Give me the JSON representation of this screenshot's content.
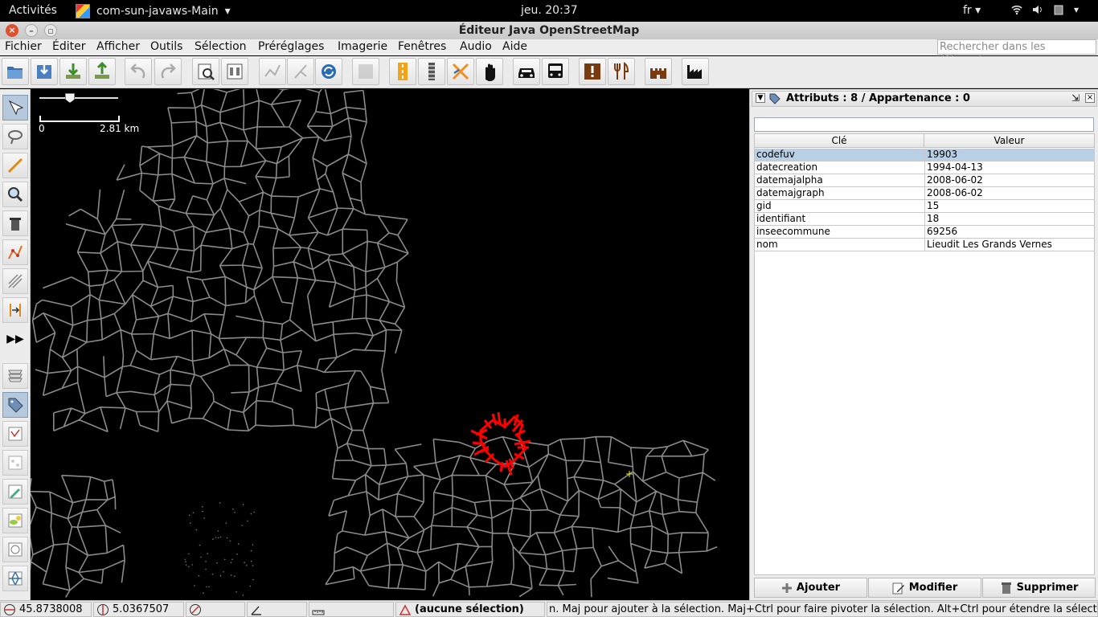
{
  "topbar": {
    "activities": "Activités",
    "app_name": "com-sun-javaws-Main",
    "clock": "jeu. 20:37",
    "language": "fr"
  },
  "window": {
    "title": "Éditeur Java OpenStreetMap"
  },
  "menubar": {
    "items": [
      "Fichier",
      "Éditer",
      "Afficher",
      "Outils",
      "Sélection",
      "Préréglages",
      "Imagerie",
      "Fenêtres",
      "Audio",
      "Aide"
    ],
    "search_placeholder": "Rechercher dans les éléments"
  },
  "toolbar": {
    "buttons": [
      "open-icon",
      "upload-file-icon",
      "download-icon",
      "upload-icon",
      "undo-icon",
      "redo-icon",
      "preferences-icon",
      "tags-icon",
      "simplify-icon",
      "align-icon",
      "refresh-icon",
      "placeholder-icon",
      "road-icon",
      "railway-icon",
      "power-icon",
      "hand-icon",
      "car-icon",
      "bus-icon",
      "warning-icon",
      "restaurant-icon",
      "castle-icon",
      "industry-icon"
    ]
  },
  "map": {
    "scale_start": "0",
    "scale_end": "2.81 km"
  },
  "panel": {
    "title": "Attributs : 8 / Appartenance : 0",
    "columns": [
      "Clé",
      "Valeur"
    ],
    "rows": [
      {
        "key": "codefuv",
        "value": "19903"
      },
      {
        "key": "datecreation",
        "value": "1994-04-13"
      },
      {
        "key": "datemajalpha",
        "value": "2008-06-02"
      },
      {
        "key": "datemajgraph",
        "value": "2008-06-02"
      },
      {
        "key": "gid",
        "value": "15"
      },
      {
        "key": "identifiant",
        "value": "18"
      },
      {
        "key": "inseecommune",
        "value": "69256"
      },
      {
        "key": "nom",
        "value": "Lieudit Les Grands Vernes"
      }
    ],
    "selected_row": 0,
    "buttons": {
      "add": "Ajouter",
      "modify": "Modifier",
      "delete": "Supprimer"
    }
  },
  "statusbar": {
    "latitude": "45.8738008",
    "longitude": "5.0367507",
    "selection": "(aucune sélection)",
    "hint": "n. Maj pour ajouter à la sélection. Maj+Ctrl pour faire pivoter la sélection. Alt+Ctrl pour étendre la sélection."
  },
  "colors": {
    "map_background": "#000000",
    "map_lines": "#8a8a8a",
    "selected_way": "#ff0000",
    "selected_row": "#b8cfe5"
  }
}
